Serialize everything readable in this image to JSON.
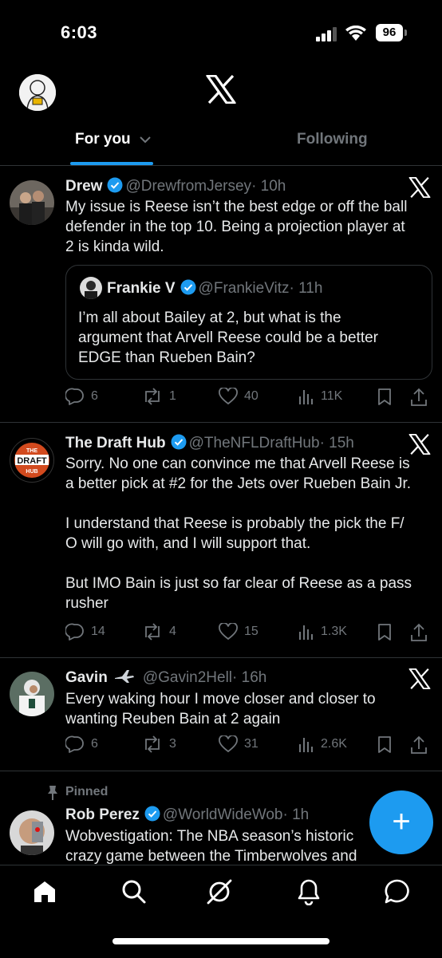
{
  "status_bar": {
    "time": "6:03",
    "battery": "96"
  },
  "tabs": {
    "for_you": "For you",
    "following": "Following"
  },
  "tweets": [
    {
      "name": "Drew",
      "handle": "@DrewfromJersey",
      "time": "· 10h",
      "lines": [
        "My issue is Reese isn’t the best edge or off the ball",
        "defender in the top 10. Being a projection player at",
        "2 is kinda wild."
      ],
      "quote": {
        "name": "Frankie V",
        "handle": "@FrankieVitz",
        "time": "· 11h",
        "lines": [
          "I’m all about Bailey at 2, but what is the",
          "argument that Arvell Reese could be a better",
          "EDGE than Rueben Bain?"
        ]
      },
      "replies": "6",
      "reposts": "1",
      "likes": "40",
      "views": "11K"
    },
    {
      "name": "The Draft Hub",
      "handle": "@TheNFLDraftHub",
      "time": "· 15h",
      "lines": [
        "Sorry. No one can convince me that Arvell Reese is",
        "a better pick at #2 for the Jets over Rueben Bain Jr.",
        "",
        "I understand that Reese is probably the pick the F/",
        "O will go with, and I will support that.",
        "",
        "But IMO Bain is just so far clear of Reese as a pass",
        "rusher"
      ],
      "avatar_text": [
        "THE",
        "DRAFT",
        "HUB"
      ],
      "replies": "14",
      "reposts": "4",
      "likes": "15",
      "views": "1.3K"
    },
    {
      "name": "Gavin",
      "handle": "@Gavin2Hell",
      "time": "· 16h",
      "lines": [
        "Every waking hour I move closer and closer to",
        "wanting Reuben Bain at 2 again"
      ],
      "replies": "6",
      "reposts": "3",
      "likes": "31",
      "views": "2.6K"
    },
    {
      "pinned": "Pinned",
      "name": "Rob Perez",
      "handle": "@WorldWideWob",
      "time": "· 1h",
      "lines": [
        "Wobvestigation: The NBA season’s historic",
        "crazy game between the Timberwolves and"
      ]
    }
  ],
  "fab": "+",
  "colors": {
    "accent": "#1d9bf0",
    "background": "#000000",
    "muted": "#71767b",
    "text": "#e7e9ea",
    "divider": "#2f3336"
  },
  "icons": [
    "x-logo",
    "verified-badge",
    "grok-x-icon",
    "reply-icon",
    "repost-icon",
    "like-icon",
    "views-icon",
    "bookmark-icon",
    "share-icon",
    "pin-icon",
    "home-icon",
    "search-icon",
    "grok-icon",
    "notifications-icon",
    "messages-icon"
  ]
}
